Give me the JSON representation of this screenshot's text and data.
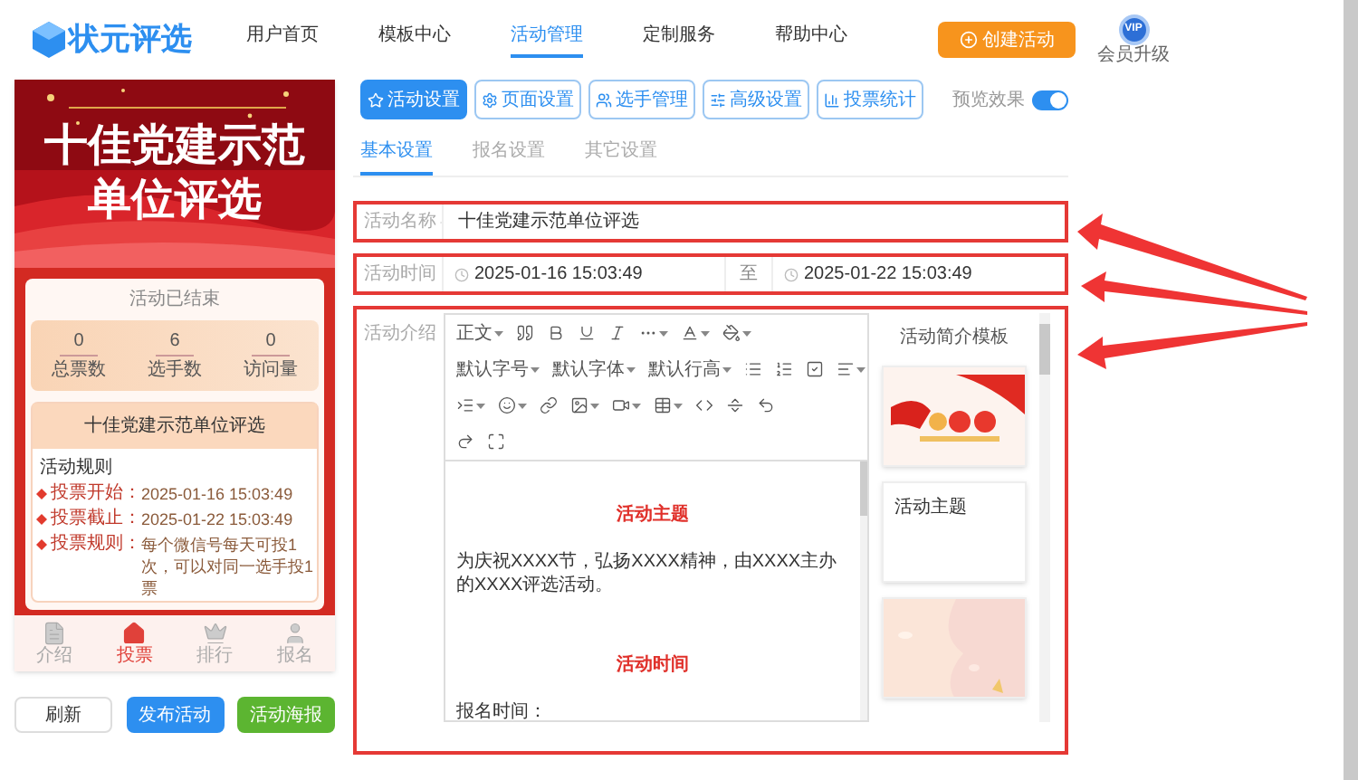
{
  "header": {
    "logo_text": "状元评选",
    "nav": [
      {
        "label": "用户首页",
        "selected": false
      },
      {
        "label": "模板中心",
        "selected": false
      },
      {
        "label": "活动管理",
        "selected": true
      },
      {
        "label": "定制服务",
        "selected": false
      },
      {
        "label": "帮助中心",
        "selected": false
      }
    ],
    "create_button": "创建活动",
    "vip": {
      "badge": "VIP",
      "label": "会员升级"
    }
  },
  "preview": {
    "banner_title": [
      "十佳党建示范",
      "单位评选"
    ],
    "status": "活动已结束",
    "stats": [
      {
        "value": "0",
        "label": "总票数"
      },
      {
        "value": "6",
        "label": "选手数"
      },
      {
        "value": "0",
        "label": "访问量"
      }
    ],
    "activity_title": "十佳党建示范单位评选",
    "rules_title": "活动规则",
    "rules": [
      {
        "label": "投票开始：",
        "value": "2025-01-16 15:03:49"
      },
      {
        "label": "投票截止：",
        "value": "2025-01-22 15:03:49"
      },
      {
        "label": "投票规则：",
        "value": "每个微信号每天可投1次，可以对同一选手投1票"
      }
    ],
    "tabbar": [
      {
        "label": "介绍",
        "selected": false
      },
      {
        "label": "投票",
        "selected": true
      },
      {
        "label": "排行",
        "selected": false
      },
      {
        "label": "报名",
        "selected": false
      }
    ],
    "buttons": [
      {
        "label": "刷新",
        "kind": "plain"
      },
      {
        "label": "发布活动",
        "kind": "primary"
      },
      {
        "label": "活动海报",
        "kind": "success"
      }
    ]
  },
  "settings_tabs": [
    {
      "label": "活动设置",
      "selected": true
    },
    {
      "label": "页面设置",
      "selected": false
    },
    {
      "label": "选手管理",
      "selected": false
    },
    {
      "label": "高级设置",
      "selected": false
    },
    {
      "label": "投票统计",
      "selected": false
    }
  ],
  "preview_toggle": {
    "label": "预览效果",
    "on": true
  },
  "sub_tabs": [
    {
      "label": "基本设置",
      "selected": true
    },
    {
      "label": "报名设置",
      "selected": false
    },
    {
      "label": "其它设置",
      "selected": false
    }
  ],
  "form": {
    "name": {
      "label": "活动名称",
      "value": "十佳党建示范单位评选"
    },
    "time": {
      "label": "活动时间",
      "start": "2025-01-16 15:03:49",
      "separator": "至",
      "end": "2025-01-22 15:03:49"
    },
    "intro": {
      "label": "活动介绍",
      "toolbar_rows": [
        [
          {
            "kind": "text",
            "label": "正文",
            "dropdown": true
          },
          {
            "kind": "icon",
            "dropdown": false
          },
          {
            "kind": "icon",
            "dropdown": false
          },
          {
            "kind": "icon",
            "dropdown": false
          },
          {
            "kind": "icon",
            "dropdown": false
          },
          {
            "kind": "icon",
            "dropdown": true
          },
          {
            "kind": "icon",
            "dropdown": true
          },
          {
            "kind": "icon",
            "dropdown": true
          }
        ],
        [
          {
            "kind": "text",
            "label": "默认字号",
            "dropdown": true
          },
          {
            "kind": "text",
            "label": "默认字体",
            "dropdown": true
          },
          {
            "kind": "text",
            "label": "默认行高",
            "dropdown": true
          },
          {
            "kind": "icon",
            "dropdown": false
          },
          {
            "kind": "icon",
            "dropdown": false
          },
          {
            "kind": "icon",
            "dropdown": false
          },
          {
            "kind": "icon",
            "dropdown": true
          }
        ],
        [
          {
            "kind": "icon",
            "dropdown": true
          },
          {
            "kind": "icon",
            "dropdown": true
          },
          {
            "kind": "icon",
            "dropdown": false
          },
          {
            "kind": "icon",
            "dropdown": true
          },
          {
            "kind": "icon",
            "dropdown": true
          },
          {
            "kind": "icon",
            "dropdown": true
          },
          {
            "kind": "icon",
            "dropdown": false
          },
          {
            "kind": "icon",
            "dropdown": false
          },
          {
            "kind": "icon",
            "dropdown": false
          }
        ],
        [
          {
            "kind": "icon",
            "dropdown": false
          },
          {
            "kind": "icon",
            "dropdown": false
          }
        ]
      ],
      "content": [
        {
          "kind": "heading",
          "text": "活动主题"
        },
        {
          "kind": "paragraph",
          "text": "为庆祝XXXX节，弘扬XXXX精神，由XXXX主办的XXXX评选活动。"
        },
        {
          "kind": "heading",
          "text": "活动时间"
        },
        {
          "kind": "paragraph",
          "text": "报名时间："
        }
      ],
      "templates": {
        "title": "活动简介模板",
        "cards": [
          {
            "kind": "picture"
          },
          {
            "kind": "text",
            "text": "活动主题"
          },
          {
            "kind": "picture"
          }
        ]
      }
    }
  }
}
